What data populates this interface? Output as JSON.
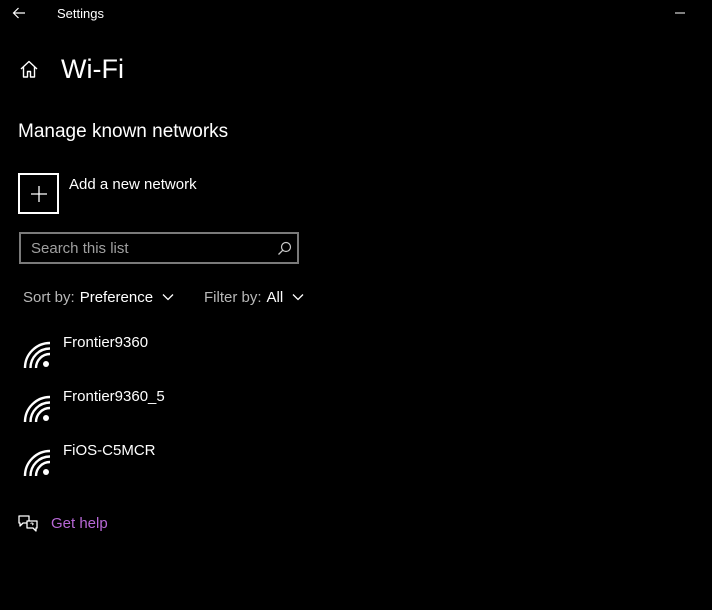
{
  "window": {
    "title": "Settings"
  },
  "header": {
    "title": "Wi-Fi"
  },
  "section": {
    "title": "Manage known networks"
  },
  "add_network": {
    "label": "Add a new network"
  },
  "search": {
    "placeholder": "Search this list",
    "value": ""
  },
  "sort": {
    "label": "Sort by:",
    "value": "Preference"
  },
  "filter": {
    "label": "Filter by:",
    "value": "All"
  },
  "networks": [
    {
      "name": "Frontier9360",
      "icon": "wifi-icon"
    },
    {
      "name": "Frontier9360_5",
      "icon": "wifi-icon"
    },
    {
      "name": "FiOS-C5MCR",
      "icon": "wifi-icon"
    }
  ],
  "help": {
    "label": "Get help",
    "icon": "help-chat-icon"
  },
  "colors": {
    "background": "#000000",
    "text": "#ffffff",
    "secondary_text": "#b8b8b8",
    "link": "#b768d6",
    "search_border": "#7a7a7a"
  }
}
